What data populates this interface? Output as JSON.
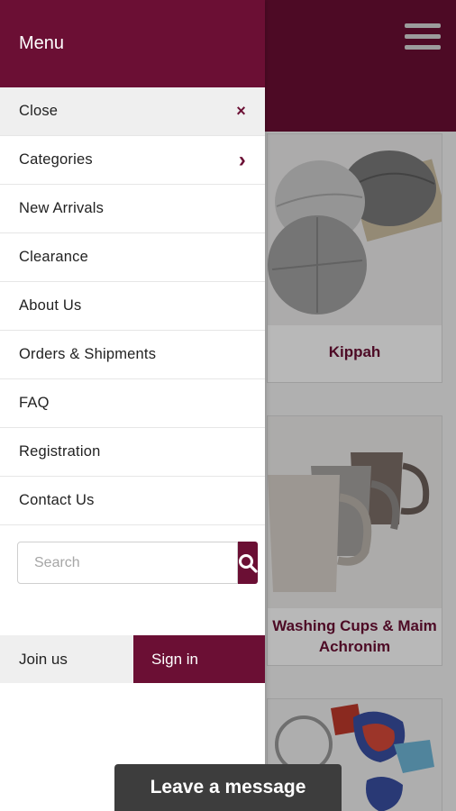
{
  "drawer": {
    "title": "Menu",
    "items": [
      {
        "label": "Close",
        "icon": "close-icon",
        "glyph": "×"
      },
      {
        "label": "Categories",
        "icon": "chevron-right-icon",
        "glyph": "›"
      },
      {
        "label": "New Arrivals"
      },
      {
        "label": "Clearance"
      },
      {
        "label": "About Us"
      },
      {
        "label": "Orders & Shipments"
      },
      {
        "label": "FAQ"
      },
      {
        "label": "Registration"
      },
      {
        "label": "Contact Us"
      }
    ],
    "search": {
      "placeholder": "Search",
      "value": ""
    },
    "join_label": "Join us",
    "signin_label": "Sign in"
  },
  "background": {
    "products": [
      {
        "name": "Kippah"
      },
      {
        "name": "Washing Cups & Maim Achronim"
      },
      {
        "name": ""
      }
    ]
  },
  "chat": {
    "label": "Leave a message"
  },
  "colors": {
    "brand": "#6b0f34",
    "drawer_bg": "#ffffff",
    "close_row_bg": "#efefef",
    "chat_bg": "#3d3d3d"
  }
}
